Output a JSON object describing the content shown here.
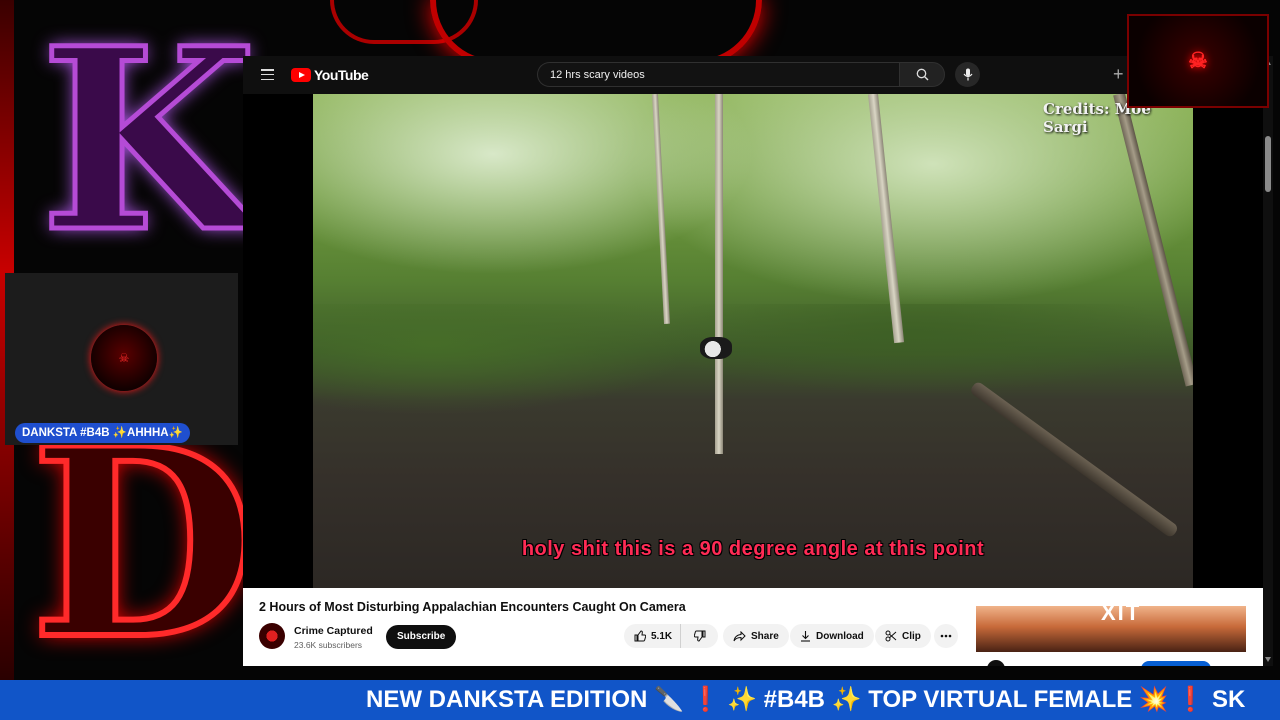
{
  "stream_overlay": {
    "cam_tag": "DANKSTA #B4B ✨AHHHA✨",
    "ticker": "NEW DANKSTA EDITION 🔪 ❗ ✨ #B4B ✨ TOP VIRTUAL FEMALE 💥 ❗ SK"
  },
  "youtube": {
    "brand": "YouTube",
    "search": {
      "value": "12 hrs scary videos"
    },
    "video": {
      "credits": "Credits: Moe Sargi",
      "subtitle": "holy shit this is a 90 degree angle at this point",
      "title": "2 Hours of Most Disturbing Appalachian Encounters Caught On Camera"
    },
    "channel": {
      "name": "Crime Captured",
      "subscribers": "23.6K subscribers",
      "subscribe_label": "Subscribe"
    },
    "actions": {
      "likes": "5.1K",
      "share": "Share",
      "download": "Download",
      "clip": "Clip"
    }
  },
  "colors": {
    "ticker_bg": "#1155c8",
    "youtube_red": "#ff0000",
    "subtitle": "#ff2b55",
    "cam_tag_bg": "#1f4fcf"
  }
}
